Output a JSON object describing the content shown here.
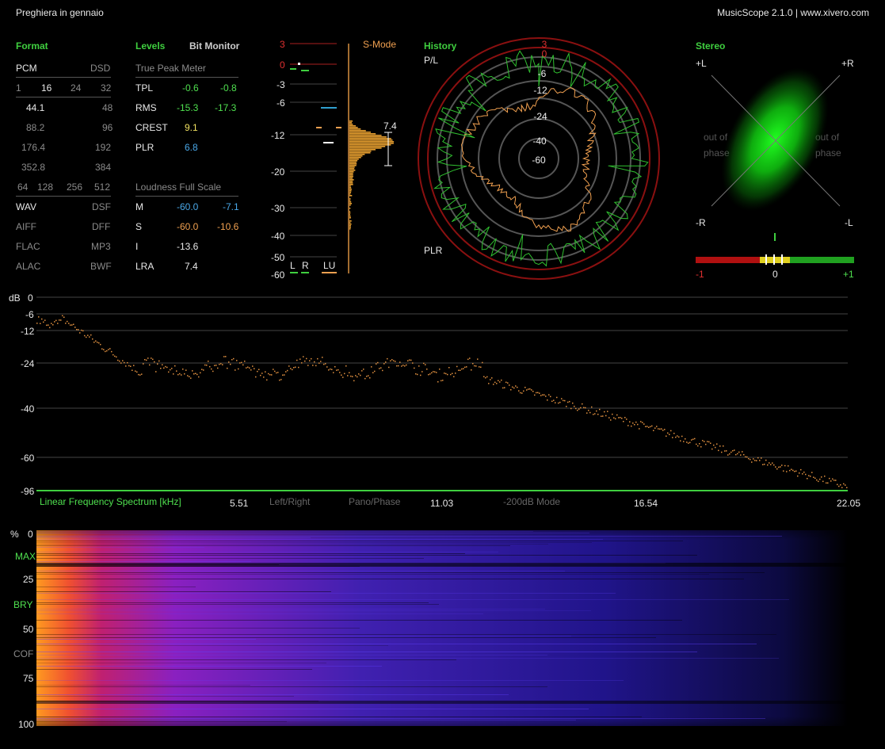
{
  "header": {
    "track_title": "Preghiera in gennaio",
    "app_title": "MusicScope 2.1.0 | www.xivero.com"
  },
  "format": {
    "title": "Format",
    "pcm": "PCM",
    "dsd": "DSD",
    "bits": [
      "1",
      "16",
      "24",
      "32"
    ],
    "rates_pcm": [
      "44.1",
      "88.2",
      "176.4",
      "352.8"
    ],
    "rates_dsd": [
      "48",
      "96",
      "192",
      "384"
    ],
    "dsd_rates": [
      "64",
      "128",
      "256",
      "512"
    ],
    "formats_left": [
      "WAV",
      "AIFF",
      "FLAC",
      "ALAC"
    ],
    "formats_right": [
      "DSF",
      "DFF",
      "MP3",
      "BWF"
    ]
  },
  "levels": {
    "title": "Levels",
    "bit_monitor": "Bit Monitor",
    "true_peak_header": "True Peak Meter",
    "rows": [
      {
        "label": "TPL",
        "v1": "-0.6",
        "v2": "-0.8"
      },
      {
        "label": "RMS",
        "v1": "-15.3",
        "v2": "-17.3"
      },
      {
        "label": "CREST",
        "v1": "9.1"
      },
      {
        "label": "PLR",
        "v1": "6.8"
      }
    ],
    "loudness_header": "Loudness Full Scale",
    "loudness": [
      {
        "label": "M",
        "v1": "-60.0",
        "v2": "-7.1"
      },
      {
        "label": "S",
        "v1": "-60.0",
        "v2": "-10.6"
      },
      {
        "label": "I",
        "v1": "-13.6"
      },
      {
        "label": "LRA",
        "v1": "7.4"
      }
    ]
  },
  "meter": {
    "mode": "S-Mode",
    "scale": [
      "3",
      "0",
      "-3",
      "-6",
      "-12",
      "-20",
      "-30",
      "-40",
      "-50",
      "-60"
    ],
    "lra_value": "7.4",
    "labels": [
      "L",
      "R",
      "LU"
    ]
  },
  "history": {
    "title": "History",
    "top_label": "P/L",
    "bottom_label": "PLR",
    "rings": [
      "3",
      "0",
      "-6",
      "-12",
      "-24",
      "-40",
      "-60"
    ]
  },
  "stereo": {
    "title": "Stereo",
    "corners": [
      "+L",
      "+R",
      "-R",
      "-L"
    ],
    "out_of_phase": "out of phase",
    "balance": [
      "-1",
      "0",
      "+1"
    ]
  },
  "spectrum": {
    "unit": "dB",
    "y_ticks": [
      "0",
      "-6",
      "-12",
      "-24",
      "-40",
      "-60",
      "-96"
    ],
    "title": "Linear Frequency Spectrum [kHz]",
    "x_ticks": [
      "5.51",
      "11.03",
      "16.54",
      "22.05"
    ],
    "modes": [
      "Left/Right",
      "Pano/Phase",
      "-200dB Mode"
    ]
  },
  "spectrogram": {
    "y_ticks": [
      "%",
      "0",
      "25",
      "50",
      "75",
      "100"
    ],
    "markers": [
      "MAX",
      "BRY",
      "COF"
    ]
  },
  "colors": {
    "accent": "#3fcf3f",
    "orange": "#f0a050",
    "blue": "#4aa8e8",
    "red": "#cc2020"
  }
}
